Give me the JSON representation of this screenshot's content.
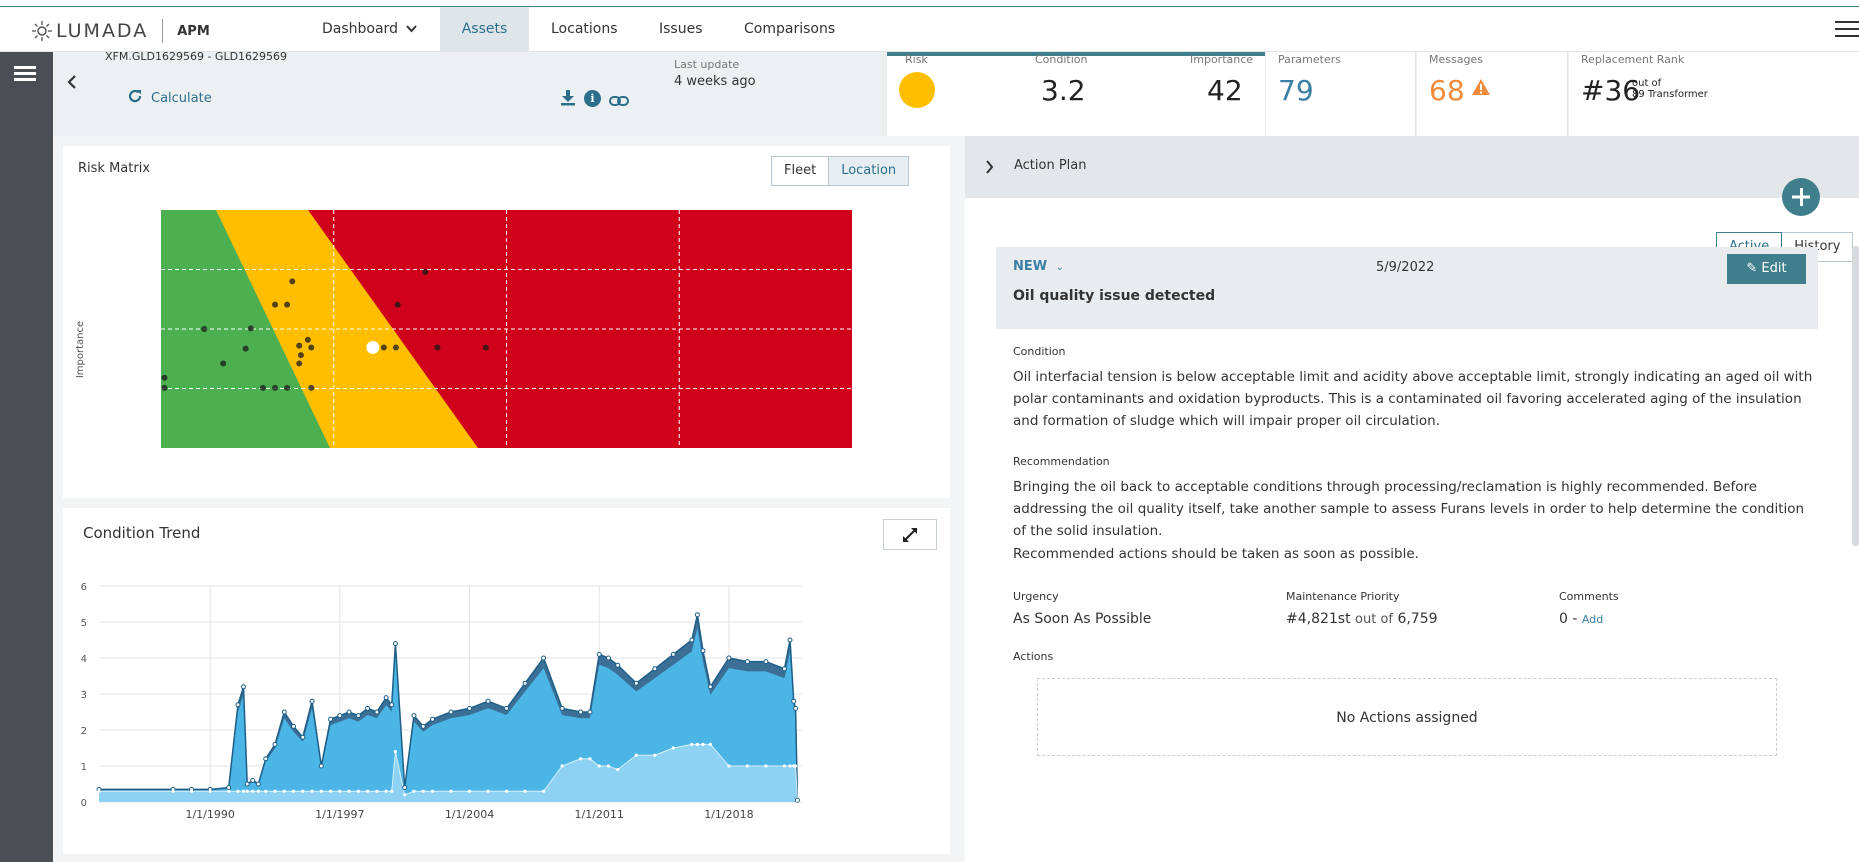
{
  "app": {
    "brand": "LUMADA",
    "product": "APM"
  },
  "nav": {
    "dashboard": "Dashboard",
    "assets": "Assets",
    "locations": "Locations",
    "issues": "Issues",
    "comparisons": "Comparisons"
  },
  "asset": {
    "id": "XFM.GLD1629569 - GLD1629569",
    "calculate": "Calculate",
    "last_update_label": "Last update",
    "last_update_value": "4 weeks ago"
  },
  "kpis": {
    "risk_label": "Risk",
    "condition_label": "Condition",
    "condition_value": "3.2",
    "importance_label": "Importance",
    "importance_value": "42",
    "parameters_label": "Parameters",
    "parameters_value": "79",
    "messages_label": "Messages",
    "messages_value": "68",
    "rank_label": "Replacement Rank",
    "rank_value": "#36",
    "rank_out_of": "out of",
    "rank_total": "89 Transformer"
  },
  "colors": {
    "accent": "#3f7f8c",
    "risk_green": "#4caf50",
    "risk_yellow": "#ffbf00",
    "risk_red": "#d0021b",
    "messages_orange": "#f08a3c",
    "chart_blue": "#4bb5e5"
  },
  "risk_matrix": {
    "title": "Risk Matrix",
    "fleet": "Fleet",
    "location": "Location",
    "y_axis_label": "Importance"
  },
  "condition_trend": {
    "title": "Condition Trend",
    "expand_icon": "expand-icon"
  },
  "action_plan": {
    "title": "Action Plan",
    "active": "Active",
    "history": "History",
    "status": "NEW",
    "date": "5/9/2022",
    "edit": "Edit",
    "issue_title": "Oil quality issue detected",
    "condition_label": "Condition",
    "condition_text": "Oil interfacial tension is below acceptable limit and acidity above acceptable limit, strongly indicating an aged oil with polar contaminants and oxidation byproducts.  This is a contaminated oil favoring accelerated aging of the insulation and formation of sludge which will impair proper oil circulation.",
    "recommendation_label": "Recommendation",
    "recommendation_text": "Bringing the oil back to acceptable conditions through processing/reclamation is highly recommended.  Before addressing the oil quality itself, take another sample to assess Furans levels in order to help determine the condition of the solid insulation.",
    "recommendation_text2": "Recommended actions should be taken as soon as possible.",
    "urgency_label": "Urgency",
    "urgency_value": "As Soon As Possible",
    "priority_label": "Maintenance Priority",
    "priority_value": "#4,821st",
    "priority_out_of": "out of",
    "priority_total": "6,759",
    "comments_label": "Comments",
    "comments_value": "0 -",
    "comments_add": "Add",
    "actions_label": "Actions",
    "no_actions": "No Actions assigned"
  },
  "chart_data": [
    {
      "type": "scatter",
      "title": "Risk Matrix",
      "ylabel": "Importance",
      "xlabel": "",
      "xlim": [
        0,
        4
      ],
      "ylim": [
        0,
        4
      ],
      "grid": true,
      "x": [
        0.02,
        0.02,
        0.25,
        0.36,
        0.49,
        0.52,
        0.59,
        0.66,
        0.66,
        0.73,
        0.73,
        0.76,
        0.8,
        0.81,
        0.8,
        0.85,
        0.87,
        0.87,
        1.29,
        1.36,
        1.37,
        1.6,
        1.53,
        1.88
      ],
      "y": [
        1.18,
        1.01,
        2.0,
        1.42,
        1.67,
        2.01,
        1.01,
        2.41,
        1.01,
        2.41,
        1.01,
        2.8,
        1.42,
        1.56,
        1.72,
        1.82,
        1.69,
        1.01,
        1.69,
        1.69,
        2.41,
        1.69,
        2.96,
        1.69
      ],
      "highlight": {
        "x": 1.29,
        "y": 1.69
      }
    },
    {
      "type": "area",
      "title": "Condition Trend",
      "xlabel": "",
      "ylabel": "",
      "ylim": [
        0,
        6
      ],
      "x_ticks": [
        "1/1/1990",
        "1/1/1997",
        "1/1/2004",
        "1/1/2011",
        "1/1/2018"
      ],
      "y_ticks": [
        0,
        1,
        2,
        3,
        4,
        5,
        6
      ],
      "grid": true,
      "x": [
        1984.0,
        1988.0,
        1989.0,
        1990.0,
        1991.0,
        1991.5,
        1991.8,
        1992.0,
        1992.3,
        1992.6,
        1993.0,
        1993.5,
        1994.0,
        1994.5,
        1995.0,
        1995.5,
        1996.0,
        1996.5,
        1997.0,
        1997.5,
        1998.0,
        1998.5,
        1999.0,
        1999.5,
        1999.8,
        2000.0,
        2000.5,
        2001.0,
        2001.5,
        2002.0,
        2003.0,
        2004.0,
        2005.0,
        2006.0,
        2007.0,
        2008.0,
        2009.0,
        2010.0,
        2010.5,
        2011.0,
        2011.5,
        2012.0,
        2013.0,
        2014.0,
        2015.0,
        2016.0,
        2016.3,
        2016.6,
        2017.0,
        2018.0,
        2019.0,
        2020.0,
        2021.0,
        2021.3,
        2021.5,
        2021.6,
        2021.7
      ],
      "series": [
        {
          "values": [
            0.35,
            0.35,
            0.35,
            0.35,
            0.4,
            2.7,
            3.2,
            0.5,
            0.6,
            0.5,
            1.2,
            1.6,
            2.5,
            2.1,
            1.8,
            2.8,
            1.0,
            2.3,
            2.4,
            2.5,
            2.4,
            2.6,
            2.5,
            2.9,
            2.7,
            4.4,
            0.4,
            2.4,
            2.1,
            2.3,
            2.5,
            2.6,
            2.8,
            2.6,
            3.3,
            4.0,
            2.6,
            2.5,
            2.5,
            4.1,
            4.0,
            3.8,
            3.3,
            3.7,
            4.1,
            4.5,
            5.2,
            4.2,
            3.2,
            4.0,
            3.9,
            3.9,
            3.7,
            4.5,
            2.8,
            2.6,
            0.05
          ]
        },
        {
          "values": [
            0.3,
            0.3,
            0.3,
            0.3,
            0.3,
            0.3,
            0.3,
            0.3,
            0.3,
            0.3,
            0.3,
            0.3,
            0.3,
            0.3,
            0.3,
            0.3,
            0.3,
            0.3,
            0.3,
            0.3,
            0.3,
            0.3,
            0.3,
            0.3,
            0.3,
            1.4,
            0.2,
            0.3,
            0.3,
            0.3,
            0.3,
            0.3,
            0.3,
            0.3,
            0.3,
            0.3,
            1.0,
            1.2,
            1.2,
            1.0,
            1.0,
            0.9,
            1.3,
            1.3,
            1.5,
            1.6,
            1.6,
            1.6,
            1.6,
            1.0,
            1.0,
            1.0,
            1.0,
            1.0,
            1.0,
            1.0,
            0.05
          ]
        }
      ]
    }
  ]
}
